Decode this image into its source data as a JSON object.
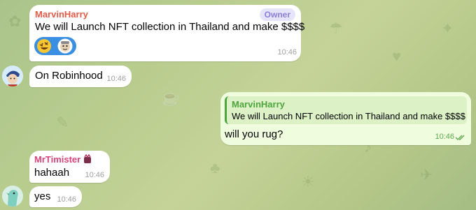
{
  "chat": {
    "messages": [
      {
        "sender": "MarvinHarry",
        "badge": "Owner",
        "text": "We will Launch NFT collection in Thailand and make $$$$",
        "reactions": [
          "rofl-emoji",
          "sticker-avatar"
        ],
        "time": "10:46"
      },
      {
        "text": "On Robinhood",
        "time": "10:46"
      },
      {
        "reply_sender": "MarvinHarry",
        "reply_text": "We will Launch NFT collection in Thailand and make $$$$",
        "text": "will you rug?",
        "time": "10:46",
        "status": "read"
      },
      {
        "sender": "MrTimister",
        "text": "hahaah",
        "time": "10:46"
      },
      {
        "text": "yes",
        "time": "10:46"
      }
    ]
  },
  "colors": {
    "marvin_name": "#e35a47",
    "timister_name": "#d8457a",
    "reply_name": "#4ea43d",
    "badge_bg": "#e6e4fa",
    "badge_text": "#8a7fd8",
    "reaction_bg": "#3a8fe2",
    "outgoing_bg": "#effdde"
  }
}
